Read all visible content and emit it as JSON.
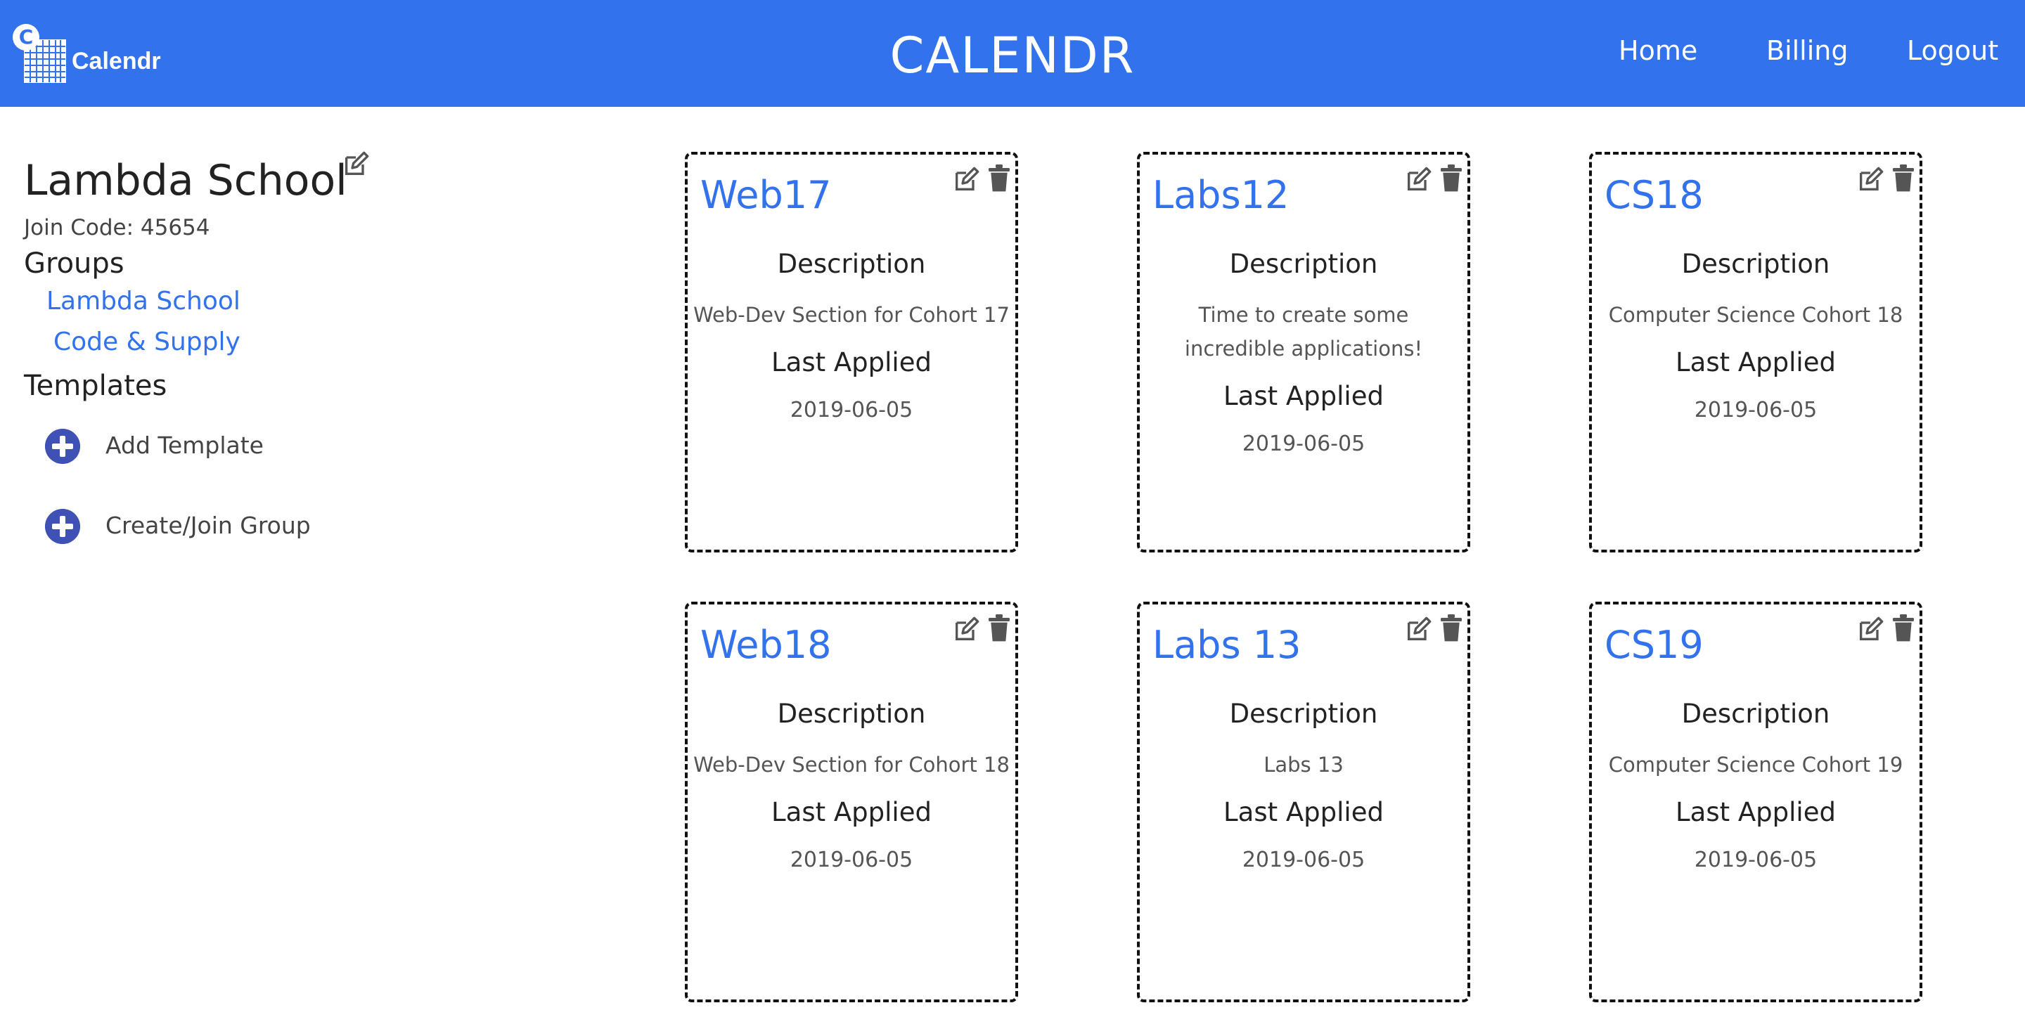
{
  "header": {
    "logo_letter": "C",
    "logo_text": "Calendr",
    "title": "CALENDR",
    "nav": {
      "home": "Home",
      "billing": "Billing",
      "logout": "Logout"
    },
    "color": "#3272ec"
  },
  "sidebar": {
    "org_name": "Lambda School",
    "join_code": "Join Code: 45654",
    "groups_title": "Groups",
    "groups": [
      "Lambda School",
      "Code & Supply"
    ],
    "templates_title": "Templates",
    "actions": {
      "add_template": "Add Template",
      "create_join_group": "Create/Join Group"
    }
  },
  "cards": [
    {
      "title": "Web17",
      "desc_label": "Description",
      "description": "Web-Dev Section for Cohort 17",
      "applied_label": "Last Applied",
      "last_applied": "2019-06-05"
    },
    {
      "title": "Labs12",
      "desc_label": "Description",
      "description": "Time to create some incredible applications!",
      "applied_label": "Last Applied",
      "last_applied": "2019-06-05"
    },
    {
      "title": "CS18",
      "desc_label": "Description",
      "description": "Computer Science Cohort 18",
      "applied_label": "Last Applied",
      "last_applied": "2019-06-05"
    },
    {
      "title": "Web18",
      "desc_label": "Description",
      "description": "Web-Dev Section for Cohort 18",
      "applied_label": "Last Applied",
      "last_applied": "2019-06-05"
    },
    {
      "title": "Labs 13",
      "desc_label": "Description",
      "description": "Labs 13",
      "applied_label": "Last Applied",
      "last_applied": "2019-06-05"
    },
    {
      "title": "CS19",
      "desc_label": "Description",
      "description": "Computer Science Cohort 19",
      "applied_label": "Last Applied",
      "last_applied": "2019-06-05"
    }
  ],
  "icons": {
    "edit": "edit-icon",
    "delete": "trash-icon",
    "add": "plus-circle-icon",
    "logo": "calendar-grid-icon"
  }
}
